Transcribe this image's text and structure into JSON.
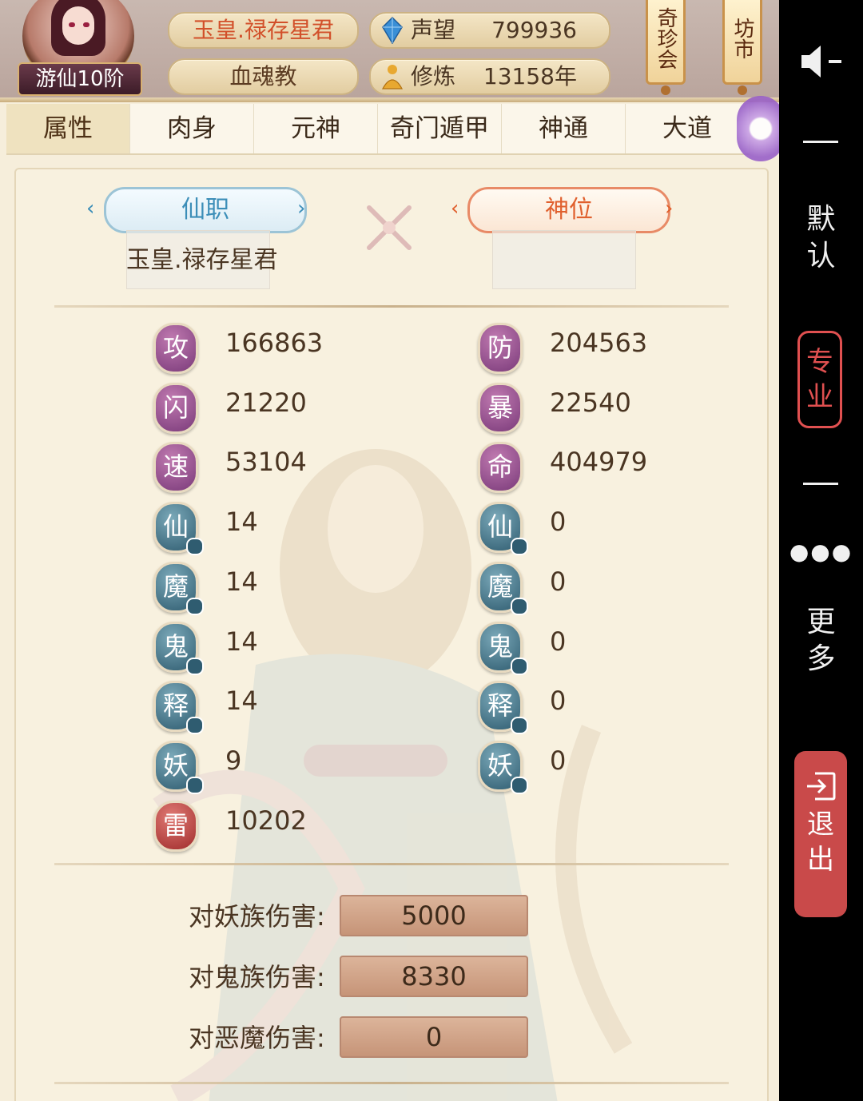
{
  "header": {
    "rank_label": "游仙10阶",
    "title": "玉皇.禄存星君",
    "sect": "血魂教",
    "reputation_label": "声望",
    "reputation_value": "799936",
    "cultivation_label": "修炼",
    "cultivation_value": "13158年",
    "banner_1": "奇珍会",
    "banner_2": "坊市"
  },
  "tabs": [
    "属性",
    "肉身",
    "元神",
    "奇门遁甲",
    "神通",
    "大道"
  ],
  "panel": {
    "left_tag": "仙职",
    "right_tag": "神位",
    "left_slot_text": "玉皇.禄存星君"
  },
  "stats_left": [
    {
      "icon": "攻",
      "value": "166863",
      "color": "purple"
    },
    {
      "icon": "闪",
      "value": "21220",
      "color": "purple"
    },
    {
      "icon": "速",
      "value": "53104",
      "color": "purple"
    },
    {
      "icon": "仙",
      "value": "14",
      "color": "teal"
    },
    {
      "icon": "魔",
      "value": "14",
      "color": "teal"
    },
    {
      "icon": "鬼",
      "value": "14",
      "color": "teal"
    },
    {
      "icon": "释",
      "value": "14",
      "color": "teal"
    },
    {
      "icon": "妖",
      "value": "9",
      "color": "teal"
    },
    {
      "icon": "雷",
      "value": "10202",
      "color": "red"
    }
  ],
  "stats_right": [
    {
      "icon": "防",
      "value": "204563",
      "color": "purple"
    },
    {
      "icon": "暴",
      "value": "22540",
      "color": "purple"
    },
    {
      "icon": "命",
      "value": "404979",
      "color": "purple"
    },
    {
      "icon": "仙",
      "value": "0",
      "color": "teal"
    },
    {
      "icon": "魔",
      "value": "0",
      "color": "teal"
    },
    {
      "icon": "鬼",
      "value": "0",
      "color": "teal"
    },
    {
      "icon": "释",
      "value": "0",
      "color": "teal"
    },
    {
      "icon": "妖",
      "value": "0",
      "color": "teal"
    }
  ],
  "damage": [
    {
      "label": "对妖族伤害:",
      "value": "5000"
    },
    {
      "label": "对鬼族伤害:",
      "value": "8330"
    },
    {
      "label": "对恶魔伤害:",
      "value": "0"
    }
  ],
  "sidebar": {
    "default_label": "默认",
    "pro_label": "专业",
    "more_label": "更多",
    "exit_label": "退出"
  }
}
